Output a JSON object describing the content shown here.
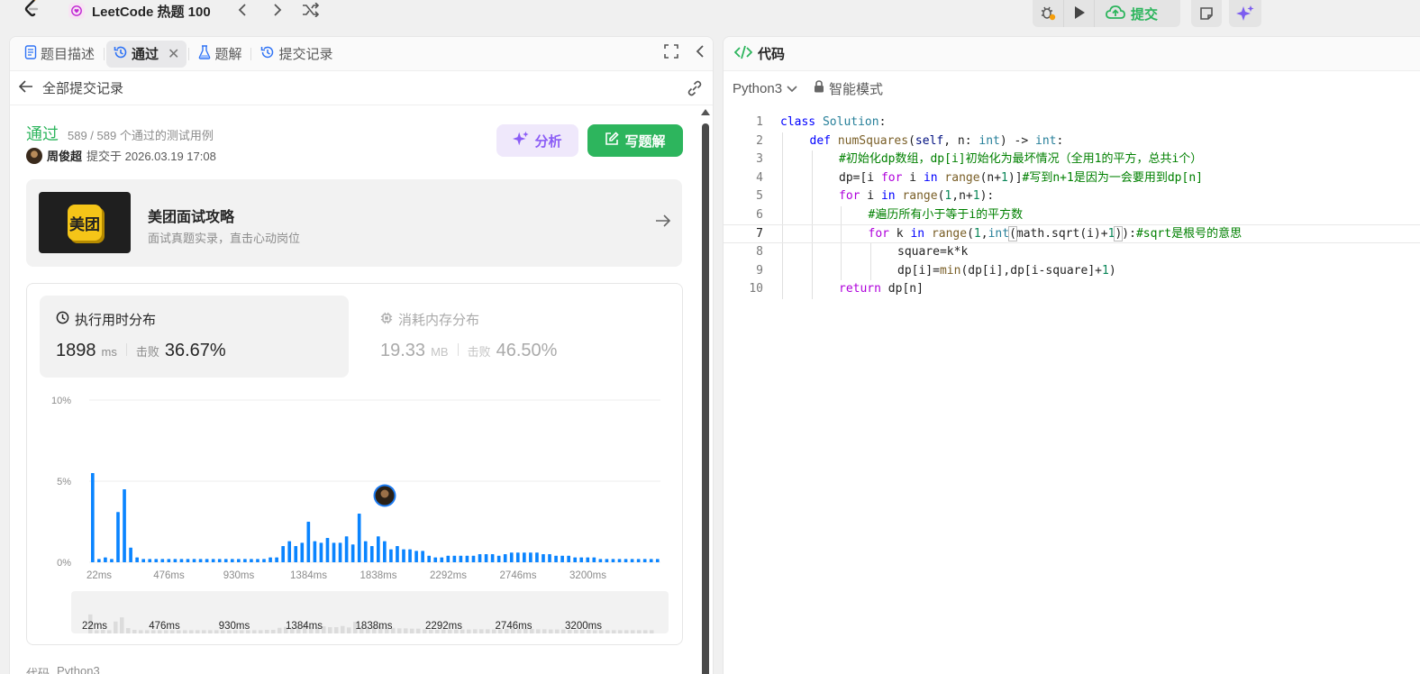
{
  "topbar": {
    "problem_list_title": "LeetCode 热题 100",
    "submit_label": "提交"
  },
  "left_tabs": {
    "description": "题目描述",
    "accepted": "通过",
    "solutions": "题解",
    "submissions": "提交记录"
  },
  "subheader": {
    "back_label": "全部提交记录"
  },
  "submission": {
    "status": "通过",
    "testcases": "589 / 589 个通过的测试用例",
    "user": "周俊超",
    "submitted_at": "提交于 2026.03.19 17:08",
    "analyze_label": "分析",
    "write_solution_label": "写题解"
  },
  "promo": {
    "logo_text": "美团",
    "title": "美团面试攻略",
    "subtitle": "面试真题实录，直击心动岗位"
  },
  "runtime": {
    "label": "执行用时分布",
    "value": "1898",
    "unit": "ms",
    "beats_label": "击败",
    "beats_pct": "36.67%"
  },
  "memory": {
    "label": "消耗内存分布",
    "value": "19.33",
    "unit": "MB",
    "beats_label": "击败",
    "beats_pct": "46.50%"
  },
  "chart_data": {
    "type": "bar",
    "y_ticks": [
      "10%",
      "5%",
      "0%"
    ],
    "ylim": [
      0,
      10
    ],
    "x_tick_labels": [
      "22ms",
      "476ms",
      "930ms",
      "1384ms",
      "1838ms",
      "2292ms",
      "2746ms",
      "3200ms"
    ],
    "values": [
      5.5,
      0.2,
      0.3,
      0.2,
      3.1,
      4.5,
      0.9,
      0.3,
      0.2,
      0.2,
      0.2,
      0.2,
      0.2,
      0.2,
      0.2,
      0.2,
      0.2,
      0.2,
      0.2,
      0.2,
      0.2,
      0.2,
      0.2,
      0.2,
      0.2,
      0.2,
      0.2,
      0.2,
      0.3,
      0.3,
      1.0,
      1.3,
      1.0,
      1.2,
      2.5,
      1.3,
      1.2,
      1.5,
      1.2,
      1.2,
      1.6,
      1.1,
      3.0,
      1.3,
      1.0,
      1.6,
      1.3,
      0.8,
      1.0,
      0.8,
      0.8,
      0.7,
      0.7,
      0.4,
      0.3,
      0.3,
      0.4,
      0.4,
      0.4,
      0.4,
      0.4,
      0.5,
      0.5,
      0.5,
      0.4,
      0.5,
      0.6,
      0.6,
      0.6,
      0.6,
      0.6,
      0.5,
      0.5,
      0.4,
      0.4,
      0.4,
      0.3,
      0.3,
      0.3,
      0.3,
      0.2,
      0.2,
      0.2,
      0.2,
      0.2,
      0.2,
      0.2,
      0.2,
      0.2,
      0.2
    ],
    "highlight_label": "1838ms",
    "bar_color": "#0a84ff"
  },
  "mini_chart": {
    "x_tick_labels": [
      "22ms",
      "476ms",
      "930ms",
      "1384ms",
      "1838ms",
      "2292ms",
      "2746ms",
      "3200ms"
    ]
  },
  "bottom_peek": {
    "label": "代码",
    "lang": "Python3"
  },
  "code_panel": {
    "title": "代码",
    "language": "Python3",
    "mode": "智能模式"
  },
  "code_lines": [
    {
      "n": "1",
      "indent": 0,
      "html": "<span style=\"color:#0000ff\">class</span> <span style=\"color:#267f99\">Solution</span>:"
    },
    {
      "n": "2",
      "indent": 1,
      "html": "<span style=\"color:#0000ff\">def</span> <span style=\"color:#795e26\">numSquares</span>(<span style=\"color:#001080\">self</span>, n: <span style=\"color:#267f99\">int</span>) -&gt; <span style=\"color:#267f99\">int</span>:"
    },
    {
      "n": "3",
      "indent": 2,
      "html": "<span style=\"color:#008000\">#初始化dp数组，dp[i]初始化为最坏情况（全用1的平方，总共i个）</span>"
    },
    {
      "n": "4",
      "indent": 2,
      "html": "dp=[i <span style=\"color:#af00db\">for</span> i <span style=\"color:#0000ff\">in</span> <span style=\"color:#795e26\">range</span>(n+<span style=\"color:#098658\">1</span>)]<span style=\"color:#008000\">#写到n+1是因为一会要用到dp[n]</span>"
    },
    {
      "n": "5",
      "indent": 2,
      "html": "<span style=\"color:#af00db\">for</span> i <span style=\"color:#0000ff\">in</span> <span style=\"color:#795e26\">range</span>(<span style=\"color:#098658\">1</span>,n+<span style=\"color:#098658\">1</span>):"
    },
    {
      "n": "6",
      "indent": 3,
      "html": "<span style=\"color:#008000\">#遍历所有小于等于i的平方数</span>"
    },
    {
      "n": "7",
      "indent": 3,
      "html": "<span style=\"color:#af00db\">for</span> k <span style=\"color:#0000ff\">in</span> <span style=\"color:#795e26\">range</span>(<span style=\"color:#098658\">1</span>,<span style=\"color:#267f99\">int</span><span style=\"outline:1px solid #bbb\">(</span>math.sqrt(i)+<span style=\"color:#098658\">1</span><span style=\"outline:1px solid #bbb\">)</span>):<span style=\"color:#008000\">#sqrt是根号的意思</span>"
    },
    {
      "n": "8",
      "indent": 4,
      "html": "square=k*k"
    },
    {
      "n": "9",
      "indent": 4,
      "html": "dp[i]=<span style=\"color:#795e26\">min</span>(dp[i],dp[i-square]+<span style=\"color:#098658\">1</span>)"
    },
    {
      "n": "10",
      "indent": 2,
      "html": "<span style=\"color:#af00db\">return</span> dp[n]"
    }
  ]
}
